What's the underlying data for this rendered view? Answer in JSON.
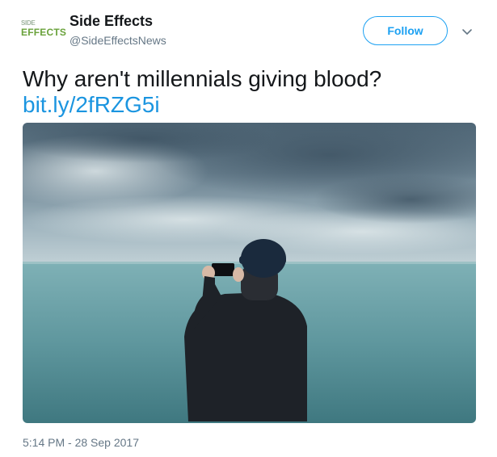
{
  "account": {
    "logo_top": "SIDE",
    "logo_bottom": "EFFECTS",
    "name": "Side Effects",
    "handle": "@SideEffectsNews"
  },
  "actions": {
    "follow_label": "Follow",
    "more_icon": "chevron-down-icon"
  },
  "tweet": {
    "text": "Why aren't millennials giving blood?",
    "link": "bit.ly/2fRZG5i",
    "timestamp": "5:14 PM - 28 Sep 2017"
  },
  "colors": {
    "accent": "#1da1f2",
    "link": "#1b95e0",
    "secondary_text": "#657786",
    "logo_green": "#6aa23b"
  }
}
